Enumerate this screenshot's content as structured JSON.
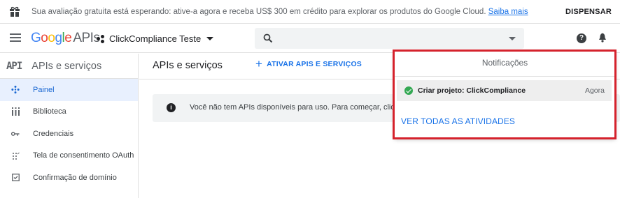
{
  "banner": {
    "message": "Sua avaliação gratuita está esperando: ative-a agora e receba US$ 300 em crédito para explorar os produtos do Google Cloud.",
    "link": "Saiba mais",
    "dismiss": "DISPENSAR"
  },
  "topbar": {
    "logo_google": [
      "G",
      "o",
      "o",
      "g",
      "l",
      "e"
    ],
    "logo_apis": "APIs",
    "project": "ClickCompliance Teste"
  },
  "sidebar": {
    "badge": "API",
    "title": "APIs e serviços",
    "items": [
      {
        "label": "Painel",
        "icon": "dashboard-icon",
        "active": true
      },
      {
        "label": "Biblioteca",
        "icon": "library-icon",
        "active": false
      },
      {
        "label": "Credenciais",
        "icon": "key-icon",
        "active": false
      },
      {
        "label": "Tela de consentimento OAuth",
        "icon": "oauth-consent-icon",
        "active": false
      },
      {
        "label": "Confirmação de domínio",
        "icon": "domain-verification-icon",
        "active": false
      }
    ]
  },
  "main": {
    "title": "APIs e serviços",
    "enable_button": "ATIVAR APIS E SERVIÇOS",
    "info_text": "Você não tem APIs disponíveis para uso. Para começar, clique e"
  },
  "notifications": {
    "title": "Notificações",
    "item_text": "Criar projeto: ClickCompliance",
    "item_time": "Agora",
    "view_all": "VER TODAS AS ATIVIDADES"
  },
  "colors": {
    "accent": "#1a73e8",
    "active_bg": "#e8f0fe",
    "highlight_border": "#d5222c",
    "success": "#34a853"
  }
}
